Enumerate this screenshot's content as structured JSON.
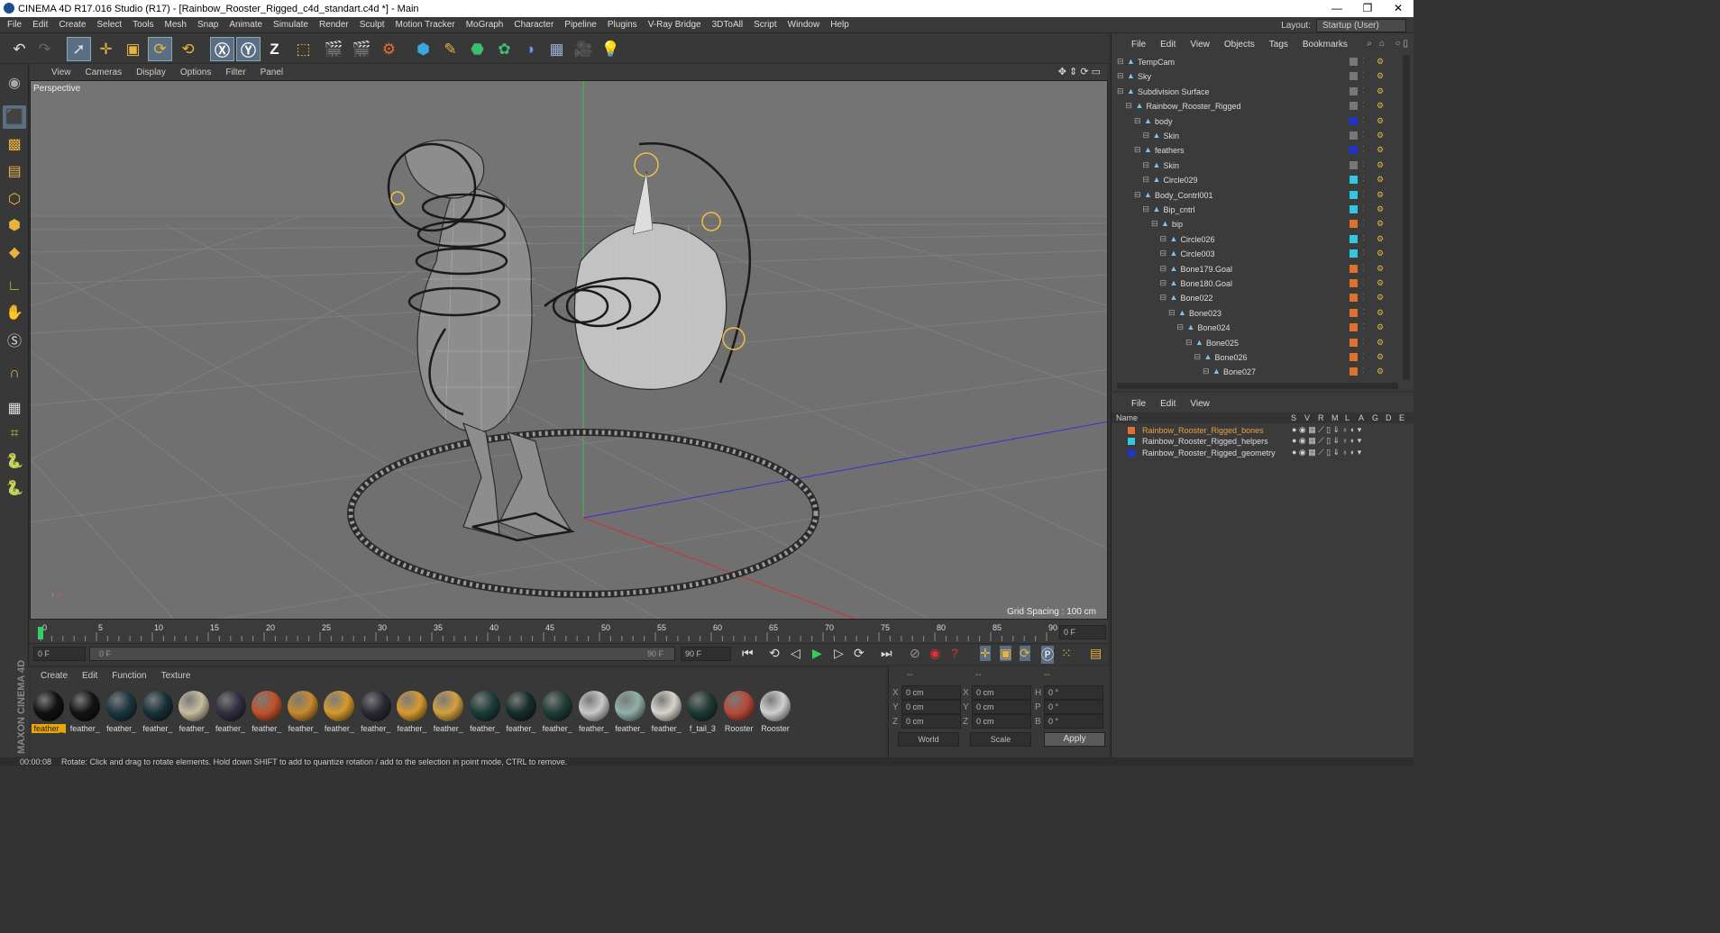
{
  "window": {
    "title": "CINEMA 4D R17.016 Studio (R17) - [Rainbow_Rooster_Rigged_c4d_standart.c4d *] - Main"
  },
  "menu": [
    "File",
    "Edit",
    "Create",
    "Select",
    "Tools",
    "Mesh",
    "Snap",
    "Animate",
    "Simulate",
    "Render",
    "Sculpt",
    "Motion Tracker",
    "MoGraph",
    "Character",
    "Pipeline",
    "Plugins",
    "V-Ray Bridge",
    "3DToAll",
    "Script",
    "Window",
    "Help"
  ],
  "layout": {
    "label": "Layout:",
    "value": "Startup (User)"
  },
  "viewport": {
    "menu": [
      "View",
      "Cameras",
      "Display",
      "Options",
      "Filter",
      "Panel"
    ],
    "label": "Perspective",
    "grid_spacing": "Grid Spacing : 100 cm"
  },
  "timeline": {
    "ticks": [
      "0",
      "5",
      "10",
      "15",
      "20",
      "25",
      "30",
      "35",
      "40",
      "45",
      "50",
      "55",
      "60",
      "65",
      "70",
      "75",
      "80",
      "85",
      "90"
    ],
    "current_frame": "0 F",
    "start": "0 F",
    "range_start": "0 F",
    "range_end": "90 F",
    "end": "90 F"
  },
  "materials": {
    "menu": [
      "Create",
      "Edit",
      "Function",
      "Texture"
    ],
    "items": [
      {
        "label": "feather_",
        "color": "#111111"
      },
      {
        "label": "feather_",
        "color": "#141414"
      },
      {
        "label": "feather_",
        "color": "#1d3640"
      },
      {
        "label": "feather_",
        "color": "#173238"
      },
      {
        "label": "feather_",
        "color": "#c8bca0"
      },
      {
        "label": "feather_",
        "color": "#303040"
      },
      {
        "label": "feather_",
        "color": "#c0532a"
      },
      {
        "label": "feather_",
        "color": "#c9892e"
      },
      {
        "label": "feather_",
        "color": "#d49a2e"
      },
      {
        "label": "feather_",
        "color": "#2a2a35"
      },
      {
        "label": "feather_",
        "color": "#d79a30"
      },
      {
        "label": "feather_",
        "color": "#d2a040"
      },
      {
        "label": "feather_",
        "color": "#1c3c38"
      },
      {
        "label": "feather_",
        "color": "#162e2a"
      },
      {
        "label": "feather_",
        "color": "#1f3d36"
      },
      {
        "label": "feather_",
        "color": "#c9c9c9"
      },
      {
        "label": "feather_",
        "color": "#8fb0a8"
      },
      {
        "label": "feather_",
        "color": "#d8d4cc"
      },
      {
        "label": "f_tail_3",
        "color": "#1e3a33"
      },
      {
        "label": "Rooster",
        "color": "#b84a3a"
      },
      {
        "label": "Rooster",
        "color": "#d0d0d0"
      }
    ]
  },
  "coords": {
    "headers": [
      "--",
      "--",
      "--"
    ],
    "rows": [
      {
        "a": "X",
        "av": "0 cm",
        "b": "X",
        "bv": "0 cm",
        "c": "H",
        "cv": "0 °"
      },
      {
        "a": "Y",
        "av": "0 cm",
        "b": "Y",
        "bv": "0 cm",
        "c": "P",
        "cv": "0 °"
      },
      {
        "a": "Z",
        "av": "0 cm",
        "b": "Z",
        "bv": "0 cm",
        "c": "B",
        "cv": "0 °"
      }
    ],
    "world": "World",
    "scale": "Scale",
    "apply": "Apply"
  },
  "objects": {
    "menu": [
      "File",
      "Edit",
      "View",
      "Objects",
      "Tags",
      "Bookmarks"
    ],
    "rows": [
      {
        "name": "TempCam",
        "indent": 0,
        "color": "#777777"
      },
      {
        "name": "Sky",
        "indent": 0,
        "color": "#777777"
      },
      {
        "name": "Subdivision Surface",
        "indent": 0,
        "color": "#777777"
      },
      {
        "name": "Rainbow_Rooster_Rigged",
        "indent": 1,
        "color": "#777777"
      },
      {
        "name": "body",
        "indent": 2,
        "color": "#2233cc"
      },
      {
        "name": "Skin",
        "indent": 3,
        "color": "#777777"
      },
      {
        "name": "feathers",
        "indent": 2,
        "color": "#2233cc"
      },
      {
        "name": "Skin",
        "indent": 3,
        "color": "#777777"
      },
      {
        "name": "Circle029",
        "indent": 3,
        "color": "#33c8e0"
      },
      {
        "name": "Body_Contrl001",
        "indent": 2,
        "color": "#33c8e0"
      },
      {
        "name": "Bip_cntrl",
        "indent": 3,
        "color": "#33c8e0"
      },
      {
        "name": "bip",
        "indent": 4,
        "color": "#e07030"
      },
      {
        "name": "Circle026",
        "indent": 5,
        "color": "#33c8e0"
      },
      {
        "name": "Circle003",
        "indent": 5,
        "color": "#33c8e0"
      },
      {
        "name": "Bone179.Goal",
        "indent": 5,
        "color": "#e07030"
      },
      {
        "name": "Bone180.Goal",
        "indent": 5,
        "color": "#e07030"
      },
      {
        "name": "Bone022",
        "indent": 5,
        "color": "#e07030"
      },
      {
        "name": "Bone023",
        "indent": 6,
        "color": "#e07030"
      },
      {
        "name": "Bone024",
        "indent": 7,
        "color": "#e07030"
      },
      {
        "name": "Bone025",
        "indent": 8,
        "color": "#e07030"
      },
      {
        "name": "Bone026",
        "indent": 9,
        "color": "#e07030"
      },
      {
        "name": "Bone027",
        "indent": 10,
        "color": "#e07030"
      }
    ]
  },
  "layers": {
    "menu": [
      "File",
      "Edit",
      "View"
    ],
    "headers": [
      "Name",
      "S",
      "V",
      "R",
      "M",
      "L",
      "A",
      "G",
      "D",
      "E"
    ],
    "rows": [
      {
        "name": "Rainbow_Rooster_Rigged_bones",
        "color": "#e07030",
        "text": "#e8a040"
      },
      {
        "name": "Rainbow_Rooster_Rigged_helpers",
        "color": "#33c8e0",
        "text": "#dddddd"
      },
      {
        "name": "Rainbow_Rooster_Rigged_geometry",
        "color": "#2233cc",
        "text": "#dddddd"
      }
    ]
  },
  "status": {
    "time": "00:00:08",
    "message": "Rotate: Click and drag to rotate elements. Hold down SHIFT to add to quantize rotation / add to the selection in point mode, CTRL to remove."
  },
  "brand": "MAXON CINEMA 4D"
}
